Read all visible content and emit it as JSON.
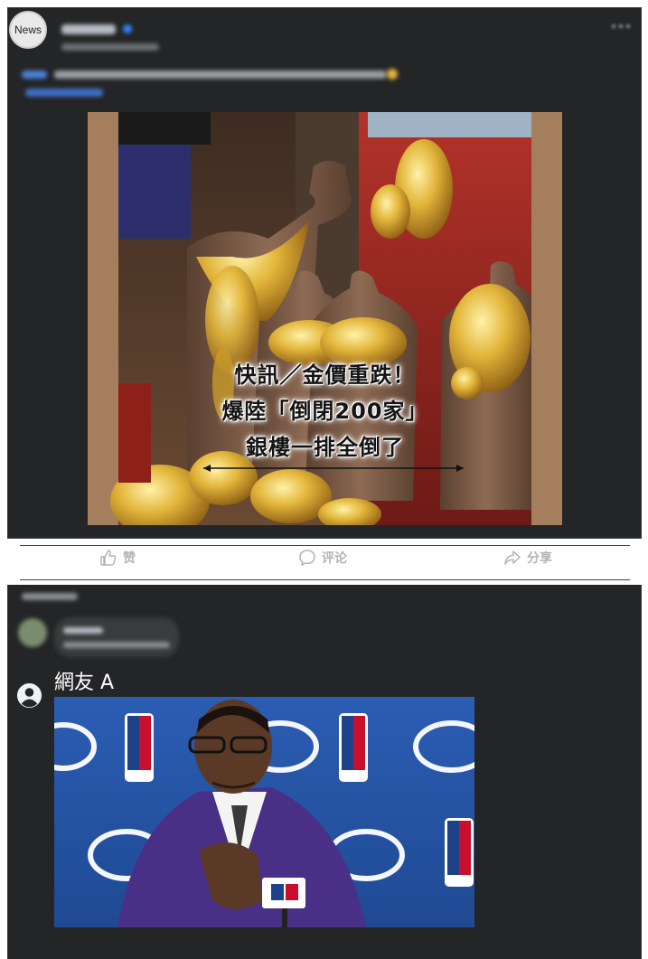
{
  "post": {
    "avatar_text": "News",
    "image_caption": {
      "line1": "快訊／金價重跌！",
      "line2": "爆陸「倒閉200家」",
      "line3": "銀樓一排全倒了"
    },
    "actions": {
      "like": "赞",
      "comment": "评论",
      "share": "分享"
    }
  },
  "comment": {
    "author": "網友 A"
  },
  "colors": {
    "card_bg": "#242526",
    "text_secondary": "#b0b3b8",
    "link_blue": "#2d88ff"
  }
}
